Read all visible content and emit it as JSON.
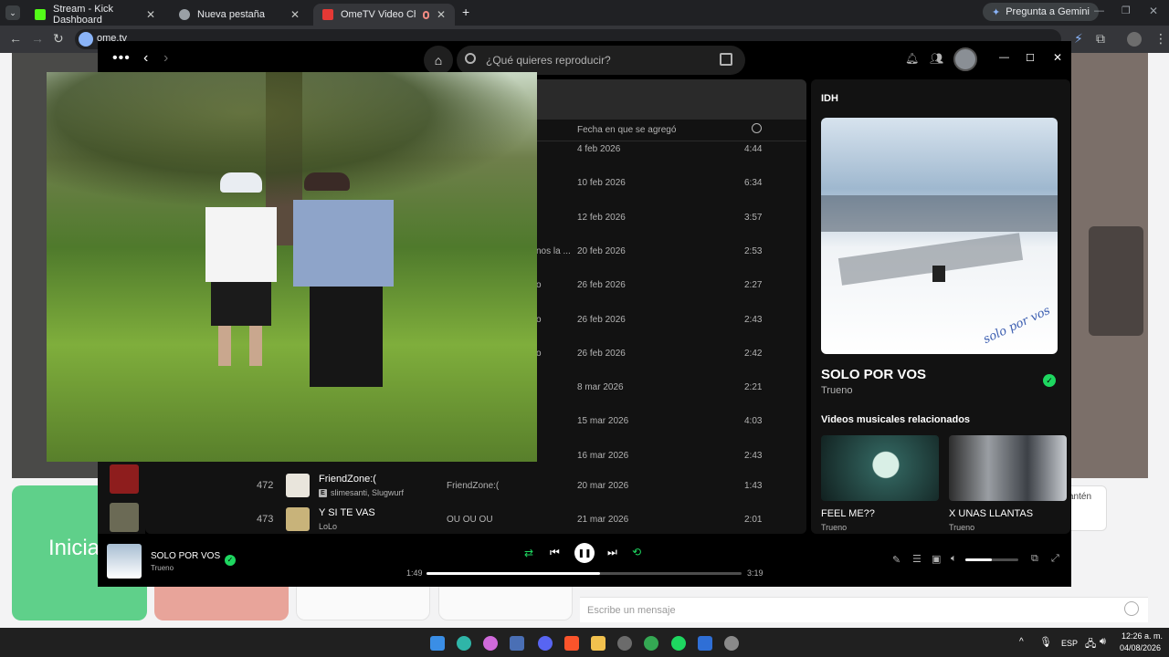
{
  "browser": {
    "tabs": [
      {
        "title": "Stream - Kick Dashboard",
        "fav": "#53fc18"
      },
      {
        "title": "Nueva pestaña",
        "fav": "#9aa0a6"
      },
      {
        "title": "OmeTV Video Chat — Ome",
        "fav": "#e53935"
      }
    ],
    "add_tab": "+",
    "gemini_label": "Pregunta a Gemini",
    "url": "ome.tv"
  },
  "spotify": {
    "search_placeholder": "¿Qué quieres reproducir?",
    "columns": {
      "date": "Fecha en que se agregó"
    },
    "rows": [
      {
        "trunc": "",
        "date": "4 feb 2026",
        "duration": "4:44"
      },
      {
        "trunc": "",
        "date": "10 feb 2026",
        "duration": "6:34"
      },
      {
        "trunc": "",
        "date": "12 feb 2026",
        "duration": "3:57"
      },
      {
        "trunc": "nos la ...",
        "date": "20 feb 2026",
        "duration": "2:53"
      },
      {
        "trunc": "o",
        "date": "26 feb 2026",
        "duration": "2:27"
      },
      {
        "trunc": "o",
        "date": "26 feb 2026",
        "duration": "2:43"
      },
      {
        "trunc": "o",
        "date": "26 feb 2026",
        "duration": "2:42"
      },
      {
        "trunc": "",
        "date": "8 mar 2026",
        "duration": "2:21"
      },
      {
        "trunc": "",
        "date": "15 mar 2026",
        "duration": "4:03"
      },
      {
        "trunc": "",
        "date": "16 mar 2026",
        "duration": "2:43"
      }
    ],
    "full_rows": [
      {
        "num": "472",
        "title": "FriendZone:(",
        "explicit": "E",
        "artists": "slimesanti, Slugwurf",
        "album": "FriendZone:(",
        "date": "20 mar 2026",
        "duration": "1:43"
      },
      {
        "num": "473",
        "title": "Y SI TE VAS",
        "explicit": "",
        "artists": "LoLo",
        "album": "OU OU OU",
        "date": "21 mar 2026",
        "duration": "2:01"
      }
    ],
    "now_playing_panel": {
      "header": "IDH",
      "title": "SOLO POR VOS",
      "artist": "Trueno",
      "cover_script": "solo por vos",
      "related_heading": "Videos musicales relacionados",
      "related": [
        {
          "title": "FEEL ME??",
          "artist": "Trueno"
        },
        {
          "title": "X UNAS LLANTAS",
          "artist": "Trueno"
        }
      ]
    },
    "player": {
      "track": "SOLO POR VOS",
      "artist": "Trueno",
      "elapsed": "1:49",
      "total": "3:19",
      "progress": 0.55,
      "volume": 0.5
    }
  },
  "ome": {
    "left_button": "Inicia",
    "side_text": "antén",
    "message_placeholder": "Escribe un mensaje"
  },
  "taskbar": {
    "lang": "ESP",
    "time": "12:26 a. m.",
    "date": "04/08/2026"
  },
  "colors": {
    "spotify_green": "#1ed760",
    "ome_green": "#5fd08a",
    "ome_red": "#e8a49a"
  }
}
